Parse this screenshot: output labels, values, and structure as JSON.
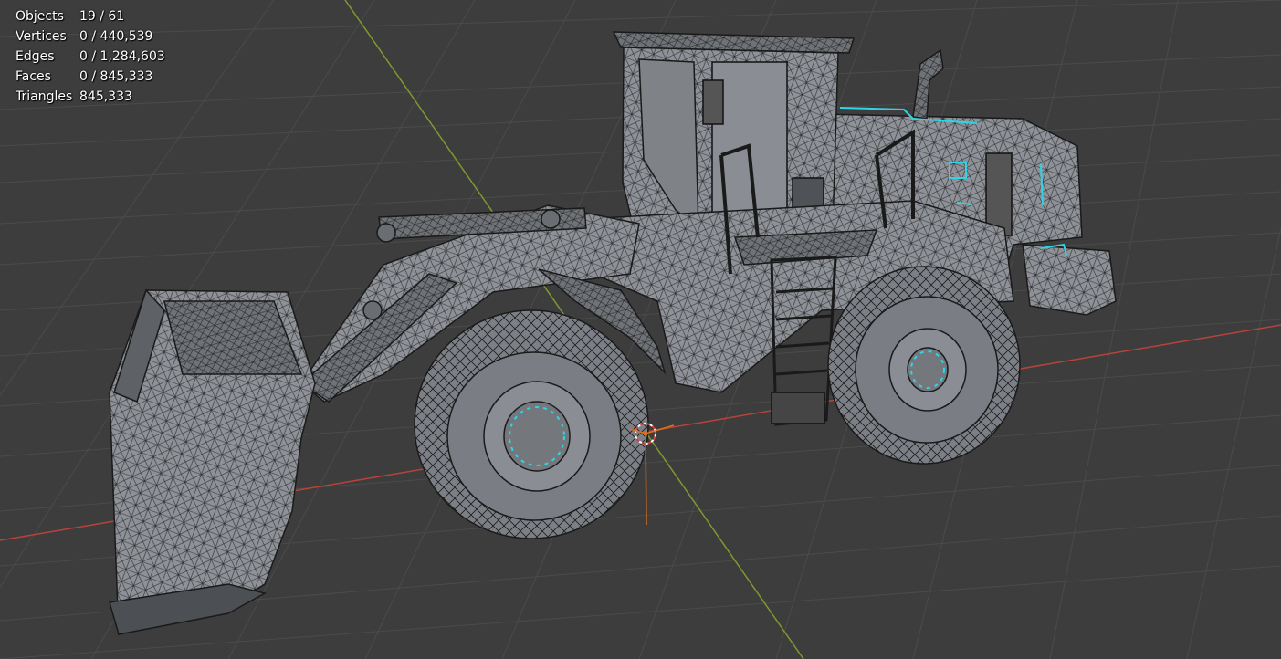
{
  "overlay": {
    "stats": [
      {
        "label": "Objects",
        "value": "19 / 61"
      },
      {
        "label": "Vertices",
        "value": "0 / 440,539"
      },
      {
        "label": "Edges",
        "value": "0 / 1,284,603"
      },
      {
        "label": "Faces",
        "value": "0 / 845,333"
      },
      {
        "label": "Triangles",
        "value": "845,333"
      }
    ]
  },
  "colors": {
    "background": "#3d3d3d",
    "grid": "#4a4a4a",
    "x_axis": "#c0463f",
    "y_axis": "#7c9a2e",
    "selection_edge": "#2fd4e6",
    "mesh_face": "#8c9096",
    "mesh_wire": "#1e1e1e",
    "origin_marker": "#e07020"
  },
  "icons": [
    "3d-cursor-icon"
  ]
}
